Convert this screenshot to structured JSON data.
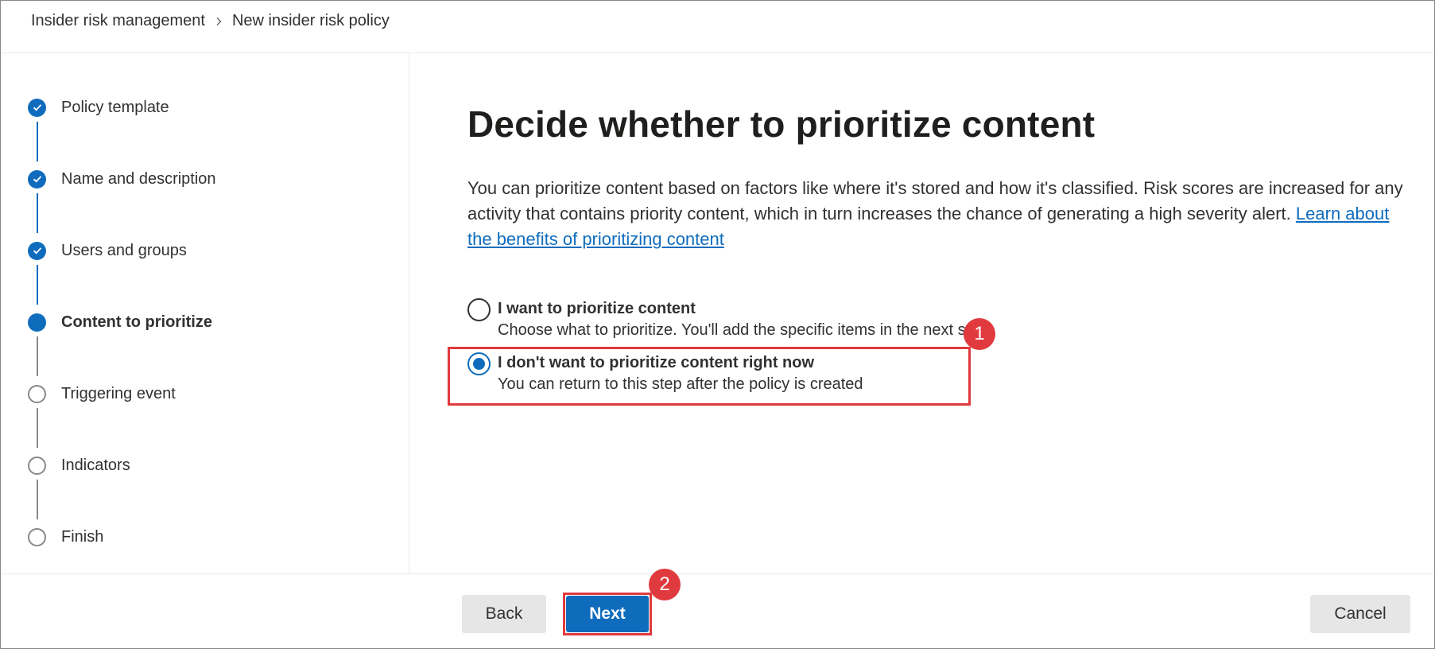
{
  "breadcrumb": {
    "items": [
      "Insider risk management",
      "New insider risk policy"
    ]
  },
  "steps": [
    {
      "label": "Policy template",
      "status": "done"
    },
    {
      "label": "Name and description",
      "status": "done"
    },
    {
      "label": "Users and groups",
      "status": "done"
    },
    {
      "label": "Content to prioritize",
      "status": "current"
    },
    {
      "label": "Triggering event",
      "status": "todo"
    },
    {
      "label": "Indicators",
      "status": "todo"
    },
    {
      "label": "Finish",
      "status": "todo"
    }
  ],
  "main": {
    "title": "Decide whether to prioritize content",
    "description": "You can prioritize content based on factors like where it's stored and how it's classified. Risk scores are increased for any activity that contains priority content, which in turn increases the chance of generating a high severity alert.",
    "link": "Learn about the benefits of prioritizing content",
    "options": [
      {
        "label": "I want to prioritize content",
        "desc": "Choose what to prioritize. You'll add the specific items in the next step.",
        "selected": false
      },
      {
        "label": "I don't want to prioritize content right now",
        "desc": "You can return to this step after the policy is created",
        "selected": true
      }
    ]
  },
  "annotations": {
    "badge1": "1",
    "badge2": "2"
  },
  "footer": {
    "back_label": "Back",
    "next_label": "Next",
    "cancel_label": "Cancel"
  },
  "colors": {
    "accent": "#0f6cbd",
    "annotation": "#e03a3e"
  },
  "icons": {
    "breadcrumb_separator": "chevron-right-icon",
    "step_done": "checkmark-icon"
  }
}
